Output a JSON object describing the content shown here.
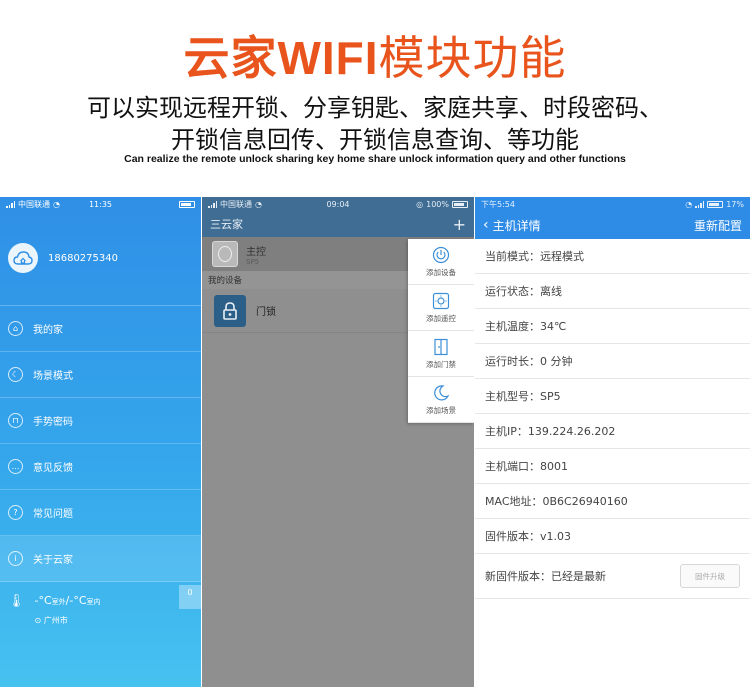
{
  "header": {
    "title_cn1": "云家",
    "title_latin": "WIFI",
    "title_cn2": "模块功能",
    "line1": "可以实现远程开锁、分享钥匙、家庭共享、时段密码、",
    "line2": "开锁信息回传、开锁信息查询、等功能",
    "english": "Can realize the remote unlock sharing key home share unlock information query and other functions"
  },
  "screen1": {
    "status": {
      "carrier": "中国联通",
      "time": "11:35"
    },
    "phone": "18680275340",
    "menu": [
      {
        "label": "我的家",
        "icon": "home-icon"
      },
      {
        "label": "场景模式",
        "icon": "moon-icon"
      },
      {
        "label": "手势密码",
        "icon": "lock-icon"
      },
      {
        "label": "意见反馈",
        "icon": "feedback-icon"
      },
      {
        "label": "常见问题",
        "icon": "question-icon"
      },
      {
        "label": "关于云家",
        "icon": "info-icon"
      }
    ],
    "weather": {
      "temp_out": "-°C",
      "out_label": "室外",
      "sep": "/",
      "temp_in": "-°C",
      "in_label": "室内",
      "city": "广州市"
    },
    "corner": "0"
  },
  "screen2": {
    "status": {
      "carrier": "中国联通",
      "time": "09:04",
      "battery": "100%"
    },
    "nav_title": "三云家",
    "nav_plus": "+",
    "host": {
      "name": "主控",
      "sub": "SP5"
    },
    "section": "我的设备",
    "device": {
      "name": "门锁"
    },
    "dropdown": [
      {
        "label": "添加设备",
        "icon": "power-icon"
      },
      {
        "label": "添加遥控",
        "icon": "remote-icon"
      },
      {
        "label": "添加门禁",
        "icon": "door-icon"
      },
      {
        "label": "添加场景",
        "icon": "moon-icon"
      }
    ]
  },
  "screen3": {
    "status": {
      "time": "下午5:54",
      "battery": "17%"
    },
    "nav_title": "主机详情",
    "nav_action": "重新配置",
    "rows": [
      "当前模式：远程模式",
      "运行状态：离线",
      "主机温度：34℃",
      "运行时长：0 分钟",
      "主机型号：SP5",
      "主机IP：139.224.26.202",
      "主机端口：8001",
      "MAC地址：0B6C26940160",
      "固件版本：v1.03",
      "新固件版本：已经是最新"
    ],
    "upgrade_button": "固件升级"
  }
}
